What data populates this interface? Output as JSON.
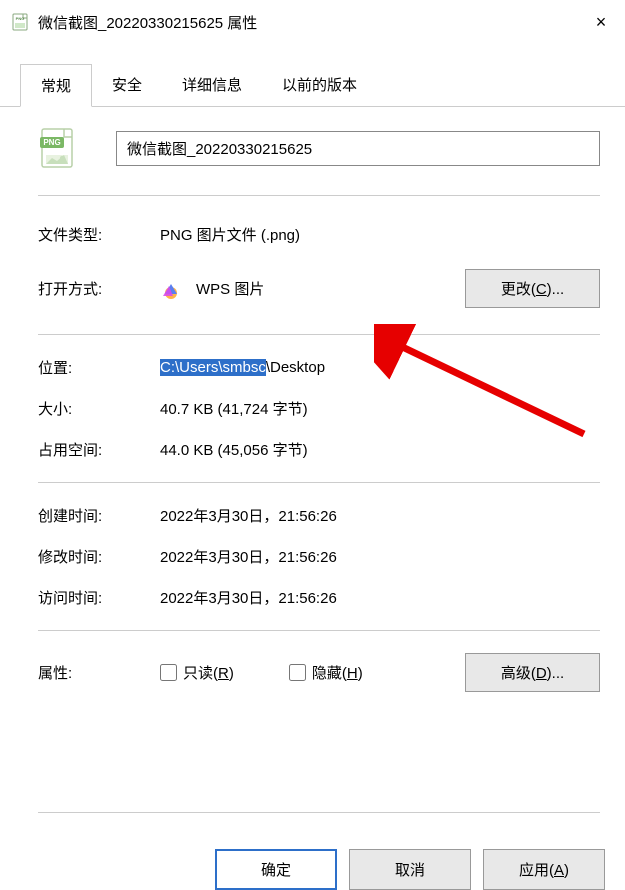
{
  "titleBar": {
    "title": "微信截图_20220330215625 属性",
    "closeLabel": "×"
  },
  "tabs": {
    "general": "常规",
    "security": "安全",
    "details": "详细信息",
    "previous": "以前的版本"
  },
  "fileName": "微信截图_20220330215625",
  "labels": {
    "fileType": "文件类型:",
    "openWith": "打开方式:",
    "location": "位置:",
    "size": "大小:",
    "sizeOnDisk": "占用空间:",
    "created": "创建时间:",
    "modified": "修改时间:",
    "accessed": "访问时间:",
    "attributes": "属性:"
  },
  "values": {
    "fileType": "PNG 图片文件 (.png)",
    "openWith": "WPS 图片",
    "locationHighlighted": "C:\\Users\\smbsc",
    "locationRest": "\\Desktop",
    "size": "40.7 KB (41,724 字节)",
    "sizeOnDisk": "44.0 KB (45,056 字节)",
    "created": "2022年3月30日，21:56:26",
    "modified": "2022年3月30日，21:56:26",
    "accessed": "2022年3月30日，21:56:26"
  },
  "buttons": {
    "change": "更改(",
    "changeKey": "C",
    "changeSuffix": ")...",
    "advanced": "高级(",
    "advancedKey": "D",
    "advancedSuffix": ")...",
    "ok": "确定",
    "cancel": "取消",
    "apply": "应用(",
    "applyKey": "A",
    "applySuffix": ")"
  },
  "checkboxes": {
    "readonly": "只读(",
    "readonlyKey": "R",
    "readonlySuffix": ")",
    "hidden": "隐藏(",
    "hiddenKey": "H",
    "hiddenSuffix": ")"
  }
}
